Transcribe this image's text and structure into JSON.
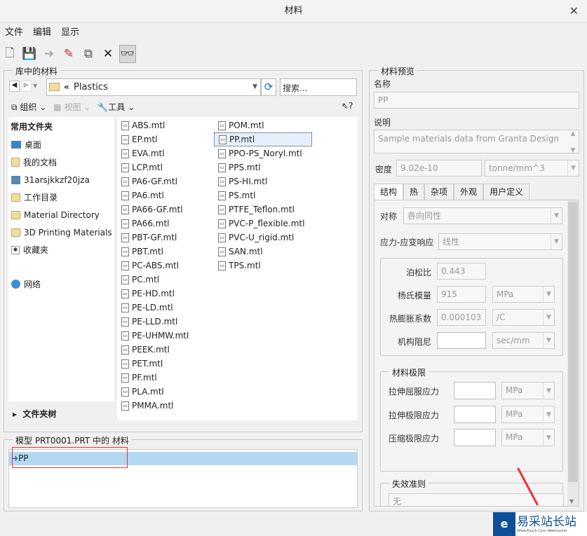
{
  "window": {
    "title": "材料",
    "close": "✕"
  },
  "menu": [
    "文件",
    "编辑",
    "显示"
  ],
  "toolbar_icons": [
    "new-icon",
    "save-icon",
    "arrow-icon",
    "edit-pencil-icon",
    "copy-icon",
    "delete-icon",
    "glasses-icon"
  ],
  "library": {
    "label": "库中的材料",
    "path": "Plastics",
    "path_prefix": "«",
    "search_placeholder": "搜索...",
    "organize": "组织",
    "view": "视图",
    "tools": "工具",
    "help": "?",
    "sidebar_header": "常用文件夹",
    "sidebar": [
      "桌面",
      "我的文档",
      "31arsjkkzf20jza",
      "工作目录",
      "Material Directory",
      "3D Printing Materials",
      "收藏夹"
    ],
    "network": "网络",
    "folder_tree": "文件夹树",
    "files_col1": [
      "ABS.mtl",
      "EP.mtl",
      "EVA.mtl",
      "LCP.mtl",
      "PA6-GF.mtl",
      "PA6.mtl",
      "PA66-GF.mtl",
      "PA66.mtl",
      "PBT-GF.mtl",
      "PBT.mtl",
      "PC-ABS.mtl",
      "PC.mtl",
      "PE-HD.mtl",
      "PE-LD.mtl",
      "PE-LLD.mtl",
      "PE-UHMW.mtl",
      "PEEK.mtl",
      "PET.mtl",
      "PF.mtl",
      "PLA.mtl",
      "PMMA.mtl"
    ],
    "files_col2": [
      "POM.mtl",
      "PP.mtl",
      "PPO-PS_Noryl.mtl",
      "PPS.mtl",
      "PS-HI.mtl",
      "PS.mtl",
      "PTFE_Teflon.mtl",
      "PVC-P_flexible.mtl",
      "PVC-U_rigid.mtl",
      "SAN.mtl",
      "TPS.mtl"
    ],
    "selected_file": "PP.mtl"
  },
  "model": {
    "label": "模型 PRT0001.PRT 中的 材料",
    "items": [
      "PP"
    ]
  },
  "preview": {
    "label": "材料预览",
    "name_label": "名称",
    "name": "PP",
    "desc_label": "说明",
    "desc": "Sample materials data from Granta Design",
    "density_label": "密度",
    "density": "9.02e-10",
    "density_unit": "tonne/mm^3",
    "tabs": [
      "结构",
      "热",
      "杂项",
      "外观",
      "用户定义"
    ],
    "symmetry_label": "对称",
    "symmetry": "各向同性",
    "stress_label": "应力-应变响应",
    "stress": "线性",
    "poisson_label": "泊松比",
    "poisson": "0.443",
    "young_label": "杨氏模量",
    "young": "915",
    "young_unit": "MPa",
    "thermal_label": "热膨胀系数",
    "thermal": "0.000103",
    "thermal_unit": "/C",
    "damping_label": "机构阻尼",
    "damping": "",
    "damping_unit": "sec/mm",
    "limits_label": "材料极限",
    "limits": [
      {
        "label": "拉伸屈服应力",
        "unit": "MPa"
      },
      {
        "label": "拉伸极限应力",
        "unit": "MPa"
      },
      {
        "label": "压缩极限应力",
        "unit": "MPa"
      }
    ],
    "failure_label": "失效准则",
    "failure": "无"
  },
  "watermark": {
    "text": "易采站长站",
    "sub": "Www.Easck.Com Webmaster"
  }
}
